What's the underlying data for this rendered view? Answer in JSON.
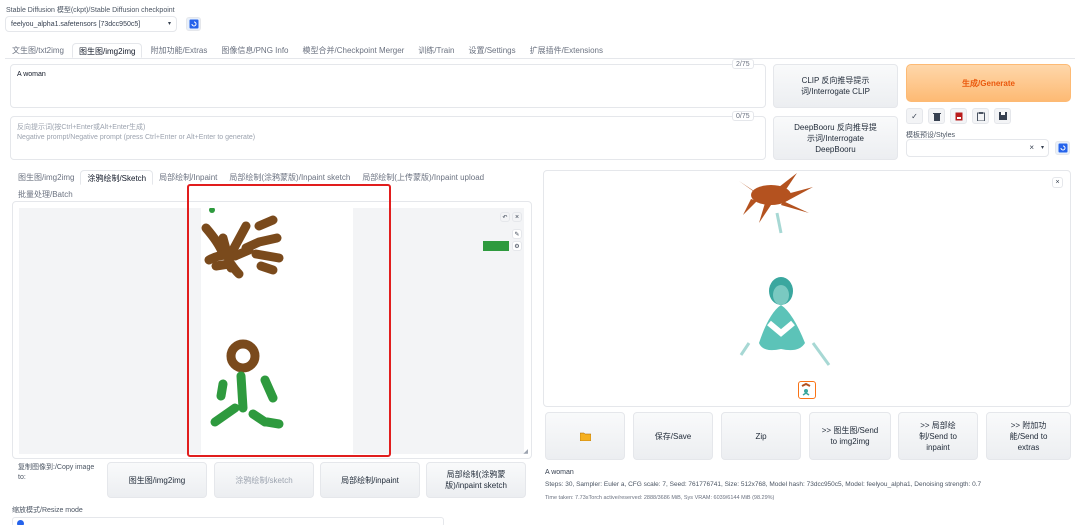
{
  "checkpoint": {
    "label": "Stable Diffusion 模型(ckpt)/Stable Diffusion checkpoint",
    "value": "feelyou_alpha1.safetensors [73dcc950c5]"
  },
  "main_tabs": [
    "文生图/txt2img",
    "图生图/img2img",
    "附加功能/Extras",
    "图像信息/PNG Info",
    "模型合并/Checkpoint Merger",
    "训练/Train",
    "设置/Settings",
    "扩展插件/Extensions"
  ],
  "prompt": {
    "value": "A woman",
    "counter": "2/75"
  },
  "neg_prompt": {
    "placeholder": "反向提示词(按Ctrl+Enter或Alt+Enter生成)\nNegative prompt/Negative prompt (press Ctrl+Enter or Alt+Enter to generate)",
    "counter": "0/75"
  },
  "buttons": {
    "clip": "CLIP 反向推导提示词/Interrogate CLIP",
    "deepbooru": "DeepBooru 反向推导提示词/Interrogate DeepBooru",
    "generate": "生成/Generate"
  },
  "styles_label": "模板预设/Styles",
  "sub_tabs": [
    "图生图/img2img",
    "涂鸦绘制/Sketch",
    "局部绘制/Inpaint",
    "局部绘制(涂鸦蒙版)/Inpaint sketch",
    "局部绘制(上传蒙版)/Inpaint upload",
    "批量处理/Batch"
  ],
  "copy_label": "复制图像到:/Copy image to:",
  "copy_buttons": [
    "图生图/img2img",
    "涂鸦绘制/sketch",
    "局部绘制/inpaint",
    "局部绘制(涂鸦蒙版)/inpaint sketch"
  ],
  "resize_label": "缩放模式/Resize mode",
  "output_buttons": [
    "保存/Save",
    "Zip",
    ">> 图生图/Send to img2img",
    ">> 局部绘制/Send to inpaint",
    ">> 附加功能/Send to extras"
  ],
  "info": {
    "prompt": "A woman",
    "params": "Steps: 30, Sampler: Euler a, CFG scale: 7, Seed: 761776741, Size: 512x768, Model hash: 73dcc950c5, Model: feelyou_alpha1, Denoising strength: 0.7",
    "time": "Time taken: 7.73sTorch active/reserved: 2888/3686 MiB, Sys VRAM: 6039/6144 MiB (98.29%)"
  },
  "colors": {
    "accent": "#f97316",
    "generate_bg": "#fdba74",
    "highlight": "#e11d1d",
    "brush_brown": "#7a4a1c",
    "brush_green": "#2e9a3e"
  },
  "icons": [
    "refresh-icon",
    "check-icon",
    "trash-icon",
    "red-card-icon",
    "clipboard-icon",
    "save-disk-icon",
    "folder-icon",
    "undo-icon",
    "close-icon",
    "brush-icon",
    "palette-icon"
  ]
}
